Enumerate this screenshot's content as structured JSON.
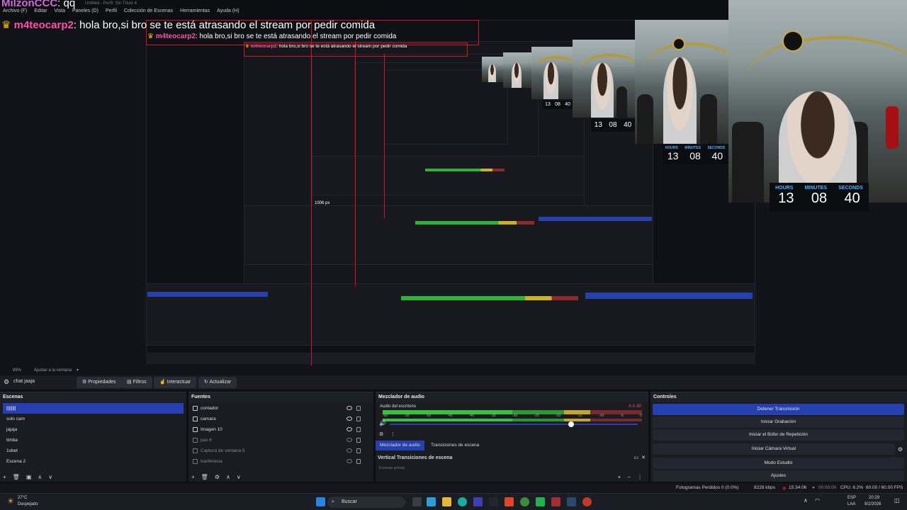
{
  "chat": {
    "top_user": "MilzonCCC",
    "top_msg": ": qq",
    "user": "m4teocarp2",
    "message": ": hola bro,si bro se te está atrasando el stream por pedir comida",
    "crown": "♛"
  },
  "window": {
    "title": "Untitled - Perfil: Sin Título 4"
  },
  "menu": [
    "Archivo (F)",
    "Editar",
    "Vista",
    "Paneles (D)",
    "Perfil",
    "Colección de Escenas",
    "Herramientas",
    "Ayuda (H)"
  ],
  "timer": {
    "labels": [
      "HOURS",
      "MINUTES",
      "SECONDS"
    ],
    "values": [
      "13",
      "08",
      "40"
    ]
  },
  "nested_label": "1006 px",
  "zoom": {
    "value": "89%",
    "fit": "Ajustar a la ventana"
  },
  "toolbar": {
    "scene_name": "chat jaaja",
    "properties": "Propiedades",
    "filters": "Filtros",
    "interact": "Interactuar",
    "refresh": "Actualizar"
  },
  "scenes": {
    "title": "Escenas",
    "items": [
      "||||||||",
      "solo cam",
      "jajaja",
      "timba",
      "1xbet",
      "Escena 2"
    ]
  },
  "sources": {
    "title": "Fuentes",
    "items": [
      {
        "label": "contador",
        "dim": false
      },
      {
        "label": "camara",
        "dim": false
      },
      {
        "label": "Imagen 10",
        "dim": false
      },
      {
        "label": "pas 6",
        "dim": true
      },
      {
        "label": "Captura de ventana 5",
        "dim": true
      },
      {
        "label": "tranferecia",
        "dim": true
      }
    ]
  },
  "mixer": {
    "title": "Mezclador de audio",
    "channel": "Audio del escritorio",
    "db": "-6.8 dB",
    "ticks": [
      "-60",
      "-55",
      "-50",
      "-45",
      "-40",
      "-35",
      "-30",
      "-25",
      "-20",
      "-15",
      "-10",
      "-5",
      "0"
    ],
    "tab_mixer": "Mezclador de audio",
    "tab_transitions": "Transiciones de escena",
    "vertical_title": "Vertical Transiciones de escena",
    "vertical_sub": "Escenas activas"
  },
  "controls": {
    "title": "Controles",
    "buttons": [
      "Detener Transmisión",
      "Iniciar Grabación",
      "Iniciar el Búfer de Repetición",
      "Iniciar Cámara Virtual",
      "Modo Estudio",
      "Ajustes"
    ]
  },
  "status": {
    "dropped": "Fotogramas Perdidos 0 (0.0%)",
    "kbps": "8228 kbps",
    "live_time": "15:34:06",
    "rec_time": "00:00:00",
    "cpu": "CPU: 6.2%",
    "fps": "60.00 / 60.00 FPS"
  },
  "taskbar": {
    "weather_temp": "27°C",
    "weather_desc": "Despejado",
    "search": "Buscar",
    "lang": "ESP",
    "lang2": "LAA",
    "time": "20:29",
    "date": "9/2/2026"
  },
  "colors": {
    "accent": "#2740b0",
    "record_red": "#d8121f",
    "timer_blue": "#4fb4ff",
    "chat_user": "#ff4fa8"
  }
}
